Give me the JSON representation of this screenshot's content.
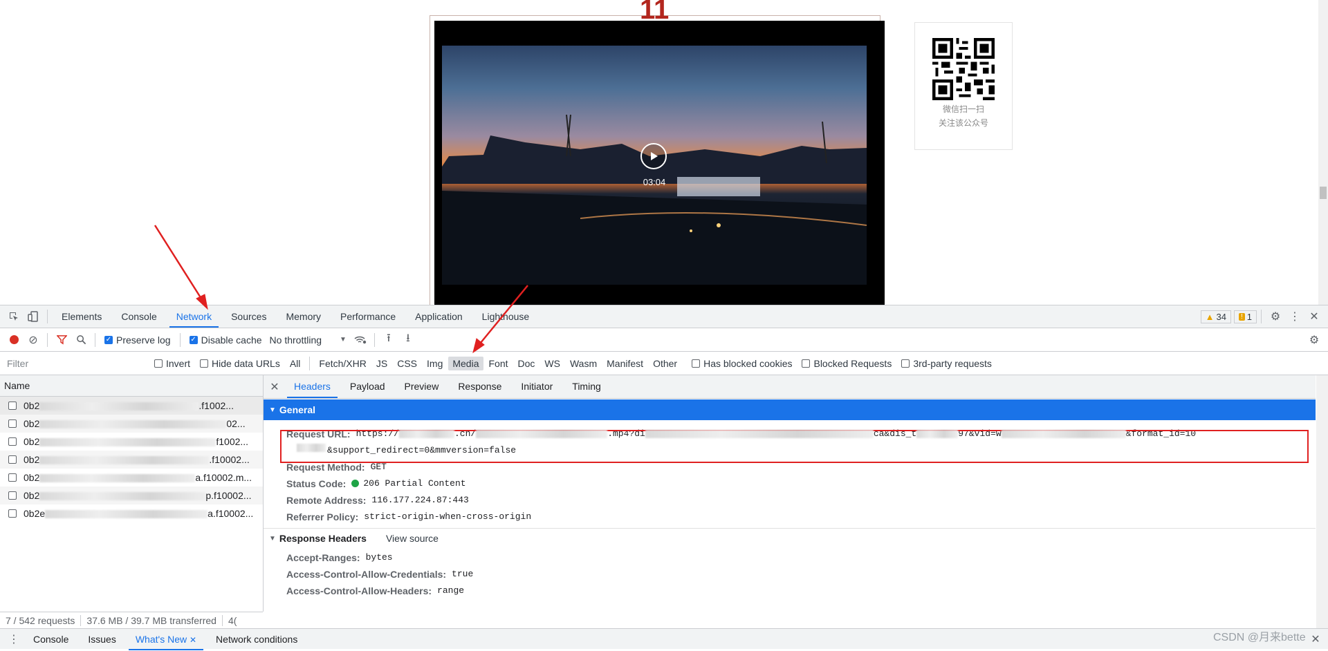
{
  "page": {
    "page_number": "11",
    "video_duration": "03:04",
    "qr_caption_line1": "微信扫一扫",
    "qr_caption_line2": "关注该公众号"
  },
  "devtools": {
    "tabs": [
      "Elements",
      "Console",
      "Network",
      "Sources",
      "Memory",
      "Performance",
      "Application",
      "Lighthouse"
    ],
    "active_tab": "Network",
    "warnings_count": "34",
    "issues_count": "1",
    "toolbar": {
      "preserve_log": "Preserve log",
      "disable_cache": "Disable cache",
      "throttling": "No throttling"
    },
    "filter": {
      "placeholder": "Filter",
      "invert": "Invert",
      "hide_data_urls": "Hide data URLs",
      "types": [
        "All",
        "Fetch/XHR",
        "JS",
        "CSS",
        "Img",
        "Media",
        "Font",
        "Doc",
        "WS",
        "Wasm",
        "Manifest",
        "Other"
      ],
      "selected_type": "Media",
      "has_blocked_cookies": "Has blocked cookies",
      "blocked_requests": "Blocked Requests",
      "third_party": "3rd-party requests"
    },
    "requests": {
      "column_name": "Name",
      "rows": [
        {
          "prefix": "0b2",
          "suffix": ".f1002..."
        },
        {
          "prefix": "0b2",
          "suffix": "02..."
        },
        {
          "prefix": "0b2",
          "suffix": "f1002..."
        },
        {
          "prefix": "0b2",
          "suffix": ".f10002..."
        },
        {
          "prefix": "0b2",
          "suffix": "a.f10002.m..."
        },
        {
          "prefix": "0b2",
          "suffix": "p.f10002..."
        },
        {
          "prefix": "0b2e",
          "suffix": "a.f10002..."
        }
      ],
      "status_requests": "7 / 542 requests",
      "status_transferred": "37.6 MB / 39.7 MB transferred",
      "status_more": "4("
    },
    "detail": {
      "tabs": [
        "Headers",
        "Payload",
        "Preview",
        "Response",
        "Initiator",
        "Timing"
      ],
      "active_tab": "Headers",
      "general_title": "General",
      "request_url_label": "Request URL:",
      "request_url_line1_a": "https://",
      "request_url_line1_b": ".cn/",
      "request_url_line1_c": ".mp4?di",
      "request_url_line1_d": "ca&dis_t",
      "request_url_line1_e": "97&vid=w",
      "request_url_line1_f": "&format_id=10",
      "request_url_line2": "&support_redirect=0&mmversion=false",
      "request_method_label": "Request Method:",
      "request_method": "GET",
      "status_code_label": "Status Code:",
      "status_code": "206 Partial Content",
      "remote_address_label": "Remote Address:",
      "remote_address": "116.177.224.87:443",
      "referrer_policy_label": "Referrer Policy:",
      "referrer_policy": "strict-origin-when-cross-origin",
      "response_headers_title": "Response Headers",
      "view_source": "View source",
      "accept_ranges_label": "Accept-Ranges:",
      "accept_ranges": "bytes",
      "acac_label": "Access-Control-Allow-Credentials:",
      "acac": "true",
      "acah_label": "Access-Control-Allow-Headers:",
      "acah": "range"
    },
    "drawer_tabs": [
      "Console",
      "Issues",
      "What's New",
      "Network conditions"
    ],
    "drawer_active": "What's New"
  },
  "watermark": "CSDN @月来bette",
  "colors": {
    "accent": "#1a73e8",
    "annotation_red": "#e02020"
  }
}
